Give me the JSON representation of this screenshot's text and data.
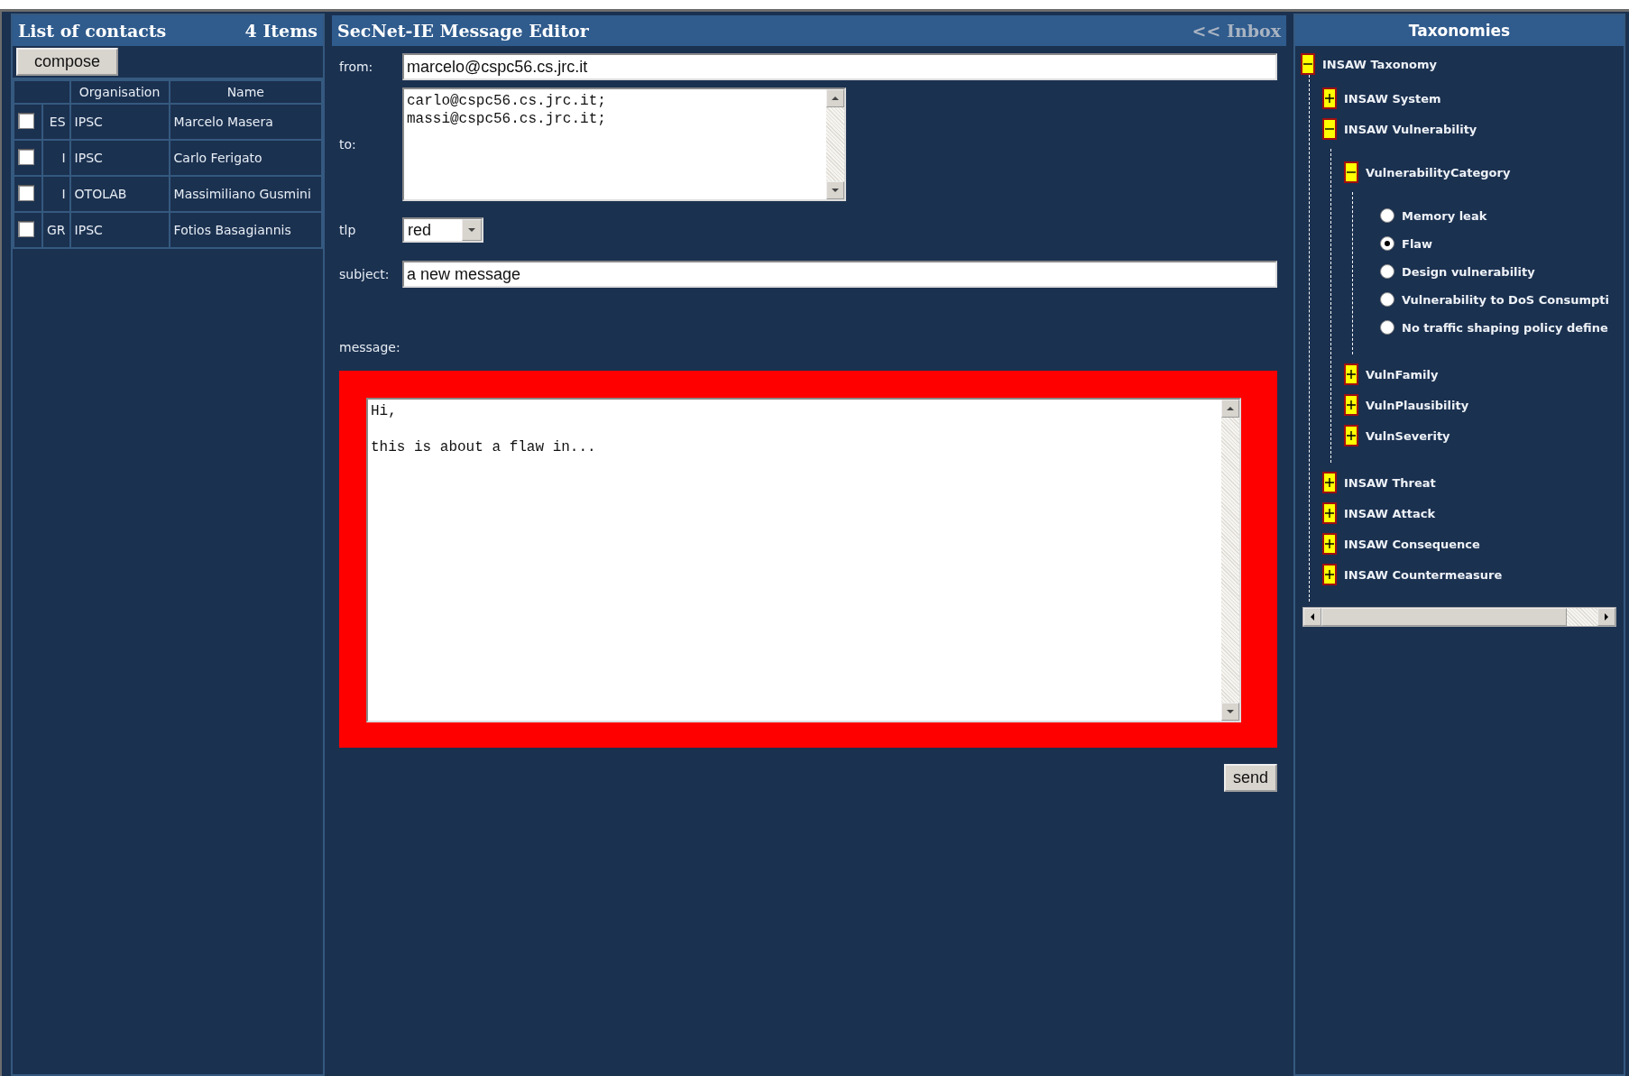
{
  "contacts": {
    "title": "List of contacts",
    "count": "4 Items",
    "compose": "compose",
    "columns": [
      "Organisation",
      "Name"
    ],
    "rows": [
      {
        "checked": false,
        "code": "ES",
        "organisation": "IPSC",
        "name": "Marcelo Masera"
      },
      {
        "checked": false,
        "code": "I",
        "organisation": "IPSC",
        "name": "Carlo Ferigato"
      },
      {
        "checked": false,
        "code": "I",
        "organisation": "OTOLAB",
        "name": "Massimiliano Gusmini"
      },
      {
        "checked": false,
        "code": "GR",
        "organisation": "IPSC",
        "name": "Fotios Basagiannis"
      }
    ]
  },
  "editor": {
    "title": "SecNet-IE Message Editor",
    "inbox_link": "<< Inbox",
    "from": {
      "label": "from:",
      "value": "marcelo@cspc56.cs.jrc.it"
    },
    "to": {
      "label": "to:",
      "value": "carlo@cspc56.cs.jrc.it;\nmassi@cspc56.cs.jrc.it;"
    },
    "tlp": {
      "label": "tlp",
      "value": "red"
    },
    "subject": {
      "label": "subject:",
      "value": "a new message"
    },
    "message": {
      "label": "message:",
      "value": "Hi,\n\nthis is about a flaw in..."
    },
    "send": "send"
  },
  "taxonomies": {
    "title": "Taxonomies",
    "tree": [
      {
        "kind": "node",
        "label": "INSAW Taxonomy",
        "expanded": true,
        "children": [
          {
            "kind": "node",
            "label": "INSAW System",
            "expanded": false
          },
          {
            "kind": "node",
            "label": "INSAW Vulnerability",
            "expanded": true,
            "children": [
              {
                "kind": "node",
                "label": "VulnerabilityCategory",
                "expanded": true,
                "children": [
                  {
                    "kind": "option",
                    "label": "Memory leak",
                    "selected": false
                  },
                  {
                    "kind": "option",
                    "label": "Flaw",
                    "selected": true
                  },
                  {
                    "kind": "option",
                    "label": "Design vulnerability",
                    "selected": false
                  },
                  {
                    "kind": "option",
                    "label": "Vulnerability to DoS Consumpti",
                    "selected": false
                  },
                  {
                    "kind": "option",
                    "label": "No traffic shaping policy define",
                    "selected": false
                  }
                ]
              },
              {
                "kind": "node",
                "label": "VulnFamily",
                "expanded": false
              },
              {
                "kind": "node",
                "label": "VulnPlausibility",
                "expanded": false
              },
              {
                "kind": "node",
                "label": "VulnSeverity",
                "expanded": false
              }
            ]
          },
          {
            "kind": "node",
            "label": "INSAW Threat",
            "expanded": false
          },
          {
            "kind": "node",
            "label": "INSAW Attack",
            "expanded": false
          },
          {
            "kind": "node",
            "label": "INSAW Consequence",
            "expanded": false
          },
          {
            "kind": "node",
            "label": "INSAW Countermeasure",
            "expanded": false
          }
        ]
      }
    ]
  }
}
